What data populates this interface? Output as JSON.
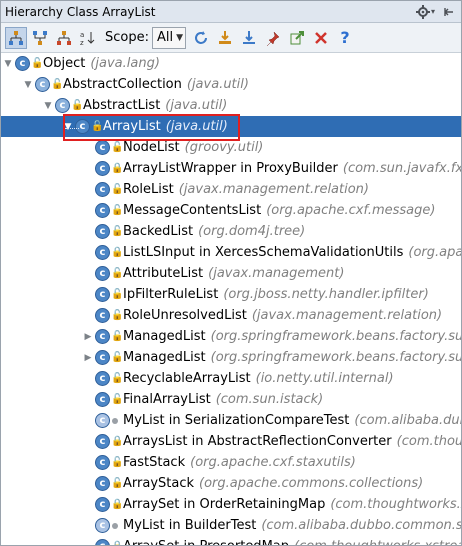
{
  "titlebar": {
    "title": "Hierarchy Class ArrayList",
    "settings_icon": "gear-icon",
    "pin_icon": "pin-icon"
  },
  "toolbar": {
    "scope_label": "Scope:",
    "scope_value": "All",
    "buttons": [
      "class-hierarchy-icon",
      "supertypes-icon",
      "subtypes-icon",
      "sort-alphabetically-icon",
      "refresh-icon",
      "export-icon",
      "expand-all-icon",
      "pin-tab-icon",
      "jump-to-source-icon",
      "close-icon",
      "help-icon"
    ],
    "colors": {
      "refresh": "#3c7ac8",
      "close": "#d0342c",
      "help": "#2d6fd0"
    }
  },
  "tree": [
    {
      "name": "Object",
      "pkg": "(java.lang)",
      "indent": 0,
      "expander": "open",
      "icon": "class",
      "lock": "open"
    },
    {
      "name": "AbstractCollection",
      "pkg": "(java.util)",
      "indent": 1,
      "expander": "open",
      "icon": "abstract",
      "lock": "open"
    },
    {
      "name": "AbstractList",
      "pkg": "(java.util)",
      "indent": 2,
      "expander": "open",
      "icon": "abstract",
      "lock": "open"
    },
    {
      "name": "ArrayList",
      "pkg": "(java.util)",
      "indent": 3,
      "expander": "open",
      "icon": "class",
      "lock": "open",
      "selected": true
    },
    {
      "name": "NodeList",
      "pkg": "(groovy.util)",
      "indent": 4,
      "expander": "",
      "icon": "class",
      "lock": "open"
    },
    {
      "name": "ArrayListWrapper in ProxyBuilder",
      "pkg": "(com.sun.javafx.fxml.",
      "indent": 4,
      "expander": "",
      "icon": "class",
      "lock": "closed"
    },
    {
      "name": "RoleList",
      "pkg": "(javax.management.relation)",
      "indent": 4,
      "expander": "",
      "icon": "class",
      "lock": "open"
    },
    {
      "name": "MessageContentsList",
      "pkg": "(org.apache.cxf.message)",
      "indent": 4,
      "expander": "",
      "icon": "class",
      "lock": "open"
    },
    {
      "name": "BackedList",
      "pkg": "(org.dom4j.tree)",
      "indent": 4,
      "expander": "",
      "icon": "class",
      "lock": "open"
    },
    {
      "name": "ListLSInput in XercesSchemaValidationUtils",
      "pkg": "(org.apach",
      "indent": 4,
      "expander": "",
      "icon": "class",
      "lock": "closed"
    },
    {
      "name": "AttributeList",
      "pkg": "(javax.management)",
      "indent": 4,
      "expander": "",
      "icon": "class",
      "lock": "open"
    },
    {
      "name": "IpFilterRuleList",
      "pkg": "(org.jboss.netty.handler.ipfilter)",
      "indent": 4,
      "expander": "",
      "icon": "class",
      "lock": "open"
    },
    {
      "name": "RoleUnresolvedList",
      "pkg": "(javax.management.relation)",
      "indent": 4,
      "expander": "",
      "icon": "class",
      "lock": "open"
    },
    {
      "name": "ManagedList",
      "pkg": "(org.springframework.beans.factory.sup",
      "indent": 4,
      "expander": "closed",
      "icon": "class",
      "lock": "open"
    },
    {
      "name": "ManagedList",
      "pkg": "(org.springframework.beans.factory.sup",
      "indent": 4,
      "expander": "closed",
      "icon": "class",
      "lock": "open"
    },
    {
      "name": "RecyclableArrayList",
      "pkg": "(io.netty.util.internal)",
      "indent": 4,
      "expander": "",
      "icon": "class",
      "lock": "open"
    },
    {
      "name": "FinalArrayList",
      "pkg": "(com.sun.istack)",
      "indent": 4,
      "expander": "",
      "icon": "class",
      "lock": "open"
    },
    {
      "name": "MyList in SerializationCompareTest",
      "pkg": "(com.alibaba.dubb",
      "indent": 4,
      "expander": "",
      "icon": "anon",
      "lock": "dot"
    },
    {
      "name": "ArraysList in AbstractReflectionConverter",
      "pkg": "(com.though",
      "indent": 4,
      "expander": "",
      "icon": "class",
      "lock": "closed"
    },
    {
      "name": "FastStack",
      "pkg": "(org.apache.cxf.staxutils)",
      "indent": 4,
      "expander": "",
      "icon": "class",
      "lock": "open"
    },
    {
      "name": "ArrayStack",
      "pkg": "(org.apache.commons.collections)",
      "indent": 4,
      "expander": "",
      "icon": "class",
      "lock": "open"
    },
    {
      "name": "ArraySet in OrderRetainingMap",
      "pkg": "(com.thoughtworks.xs",
      "indent": 4,
      "expander": "",
      "icon": "class",
      "lock": "closed"
    },
    {
      "name": "MyList in BuilderTest",
      "pkg": "(com.alibaba.dubbo.common.se",
      "indent": 4,
      "expander": "",
      "icon": "anon",
      "lock": "dot"
    },
    {
      "name": "ArraySet in PresortedMap",
      "pkg": "(com.thoughtworks.xstream",
      "indent": 4,
      "expander": "",
      "icon": "class",
      "lock": "closed"
    }
  ]
}
